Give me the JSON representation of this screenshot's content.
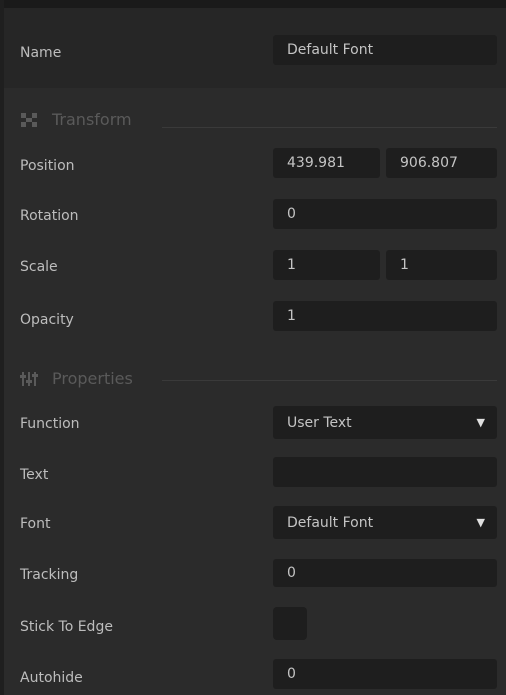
{
  "name_row": {
    "label": "Name",
    "value": "Default Font"
  },
  "transform": {
    "title": "Transform",
    "icon": "transform-icon",
    "position": {
      "label": "Position",
      "x": "439.981",
      "y": "906.807"
    },
    "rotation": {
      "label": "Rotation",
      "value": "0"
    },
    "scale": {
      "label": "Scale",
      "x": "1",
      "y": "1"
    },
    "opacity": {
      "label": "Opacity",
      "value": "1"
    }
  },
  "properties": {
    "title": "Properties",
    "icon": "sliders-icon",
    "function": {
      "label": "Function",
      "value": "User Text"
    },
    "text": {
      "label": "Text",
      "value": ""
    },
    "font": {
      "label": "Font",
      "value": "Default Font"
    },
    "tracking": {
      "label": "Tracking",
      "value": "0"
    },
    "stick_to_edge": {
      "label": "Stick To Edge",
      "checked": false
    },
    "autohide": {
      "label": "Autohide",
      "value": "0"
    }
  },
  "colors": {
    "background": "#2b2b2b",
    "field": "#1e1e1e",
    "label": "#bdbdbd",
    "section_title": "#5a5a5a"
  }
}
